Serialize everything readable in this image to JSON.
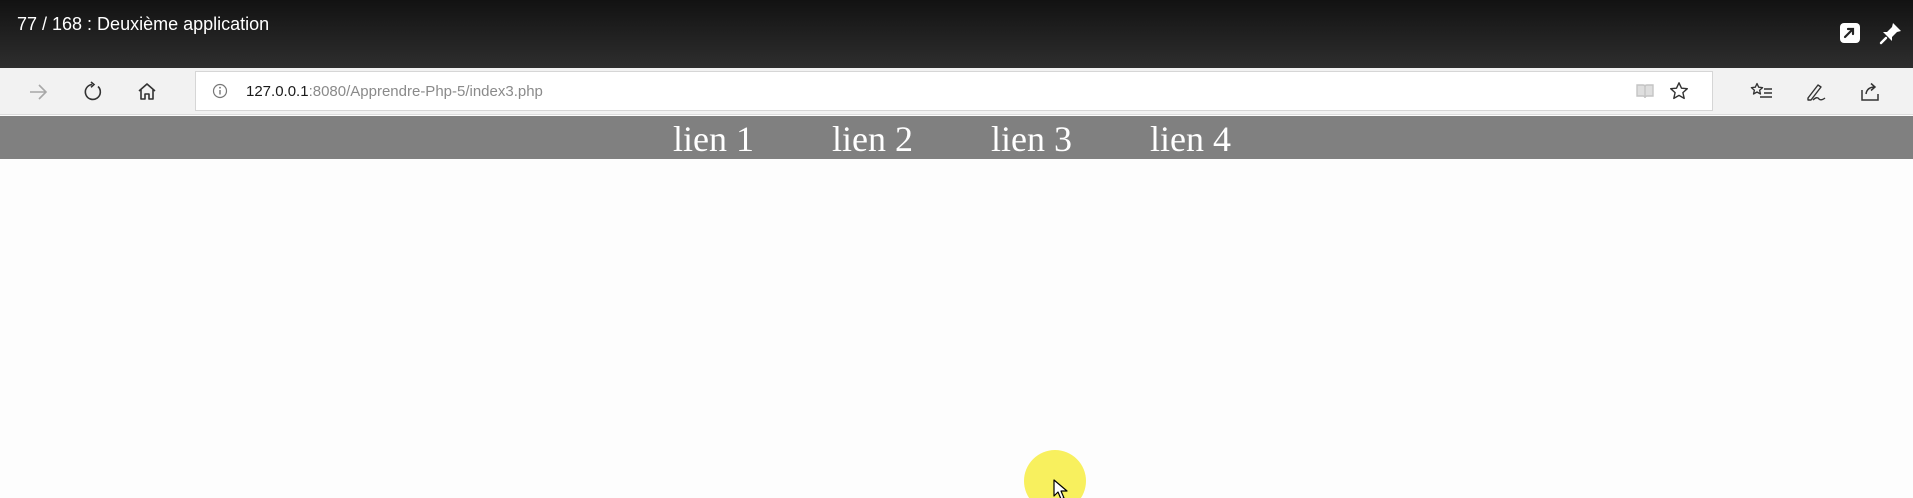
{
  "overlay": {
    "title": "77 / 168 : Deuxième application",
    "icons": [
      "share-arrow-icon",
      "pin-icon"
    ]
  },
  "browser": {
    "icons": [
      "forward-icon",
      "refresh-icon",
      "home-icon",
      "info-icon",
      "reading-view-icon",
      "favorite-star-icon",
      "favorites-list-icon",
      "pen-icon",
      "share-icon"
    ],
    "address": {
      "host": "127.0.0.1",
      "path": ":8080/Apprendre-Php-5/index3.php"
    }
  },
  "page": {
    "nav_background": "#808080",
    "links": [
      "lien 1",
      "lien 2",
      "lien 3",
      "lien 4"
    ]
  },
  "cursor": {
    "halo_color": "#f7ef50"
  }
}
